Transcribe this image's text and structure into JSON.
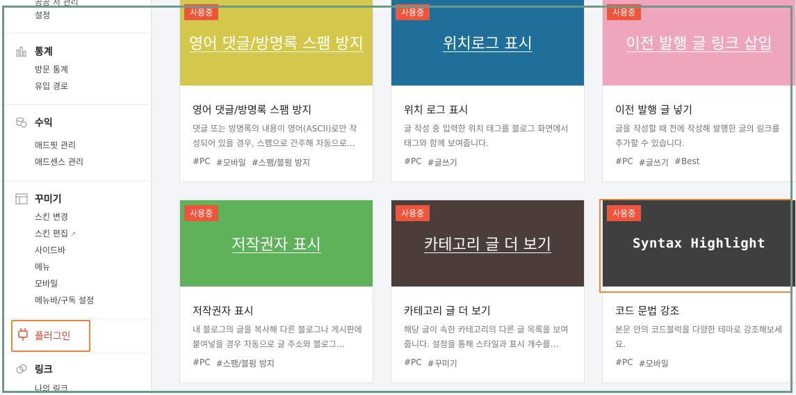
{
  "sidebar": {
    "top_cut": "공공 서 관리",
    "setting": "설정",
    "stats": {
      "label": "통계",
      "items": [
        "방문 통계",
        "유입 경로"
      ]
    },
    "revenue": {
      "label": "수익",
      "items": [
        "애드핏 관리",
        "애드센스 관리"
      ]
    },
    "decorate": {
      "label": "꾸미기",
      "items": [
        "스킨 변경",
        "스킨 편집",
        "사이드바",
        "메뉴",
        "모바일",
        "메뉴바/구독 설정"
      ]
    },
    "plugin": {
      "label": "플러그인"
    },
    "link": {
      "label": "링크",
      "items": [
        "나의 링크"
      ]
    }
  },
  "badge_label": "사용중",
  "cards": [
    {
      "thumb_title": "영어 댓글/방명록 스팸 방지",
      "title": "영어 댓글/방명록 스팸 방지",
      "desc": "댓글 또는 방명록의 내용이 영어(ASCII)로만 작성되어 있을 경우, 스팸으로 간주해 자동으로…",
      "tags": [
        "#PC",
        "#모바일",
        "#스팸/블펌 방지"
      ],
      "color": "#d4c84a"
    },
    {
      "thumb_title": "위치로그 표시",
      "title": "위치 로그 표시",
      "desc": "글 작성 중 입력한 위치 태그를 블로그 화면에서 태그와 함께 보여줍니다.",
      "tags": [
        "#PC",
        "#글쓰기"
      ],
      "color": "#1e6f9a"
    },
    {
      "thumb_title": "이전 발행 글 링크 삽입",
      "title": "이전 발행 글 넣기",
      "desc": "글을 작성할 때 전에 작성해 발행한 글의 링크를 추가할 수 있습니다.",
      "tags": [
        "#PC",
        "#글쓰기",
        "#Best"
      ],
      "color": "#eea6bc"
    },
    {
      "thumb_title": "저작권자 표시",
      "title": "저작권자 표시",
      "desc": "내 블로그의 글을 복사해 다른 블로그나 게시판에 붙여넣을 경우 자동으로 글 주소와 블로그…",
      "tags": [
        "#PC",
        "#스팸/블펌 방지"
      ],
      "color": "#5fb15a"
    },
    {
      "thumb_title": "카테고리 글 더 보기",
      "title": "카테고리 글 더 보기",
      "desc": "해당 글이 속한 카테고리의 다른 글 목록을 보여줍니다. 설정을 통해 스타일과 표시 개수를…",
      "tags": [
        "#PC",
        "#꾸미기"
      ],
      "color": "#4b3e3a"
    },
    {
      "thumb_title": "Syntax Highlight",
      "title": "코드 문법 강조",
      "desc": "본문 안의 코드블럭을 다양한 테마로 강조해보세요.",
      "tags": [
        "#PC",
        "#모바일"
      ],
      "color": "#3f3f3f"
    }
  ]
}
